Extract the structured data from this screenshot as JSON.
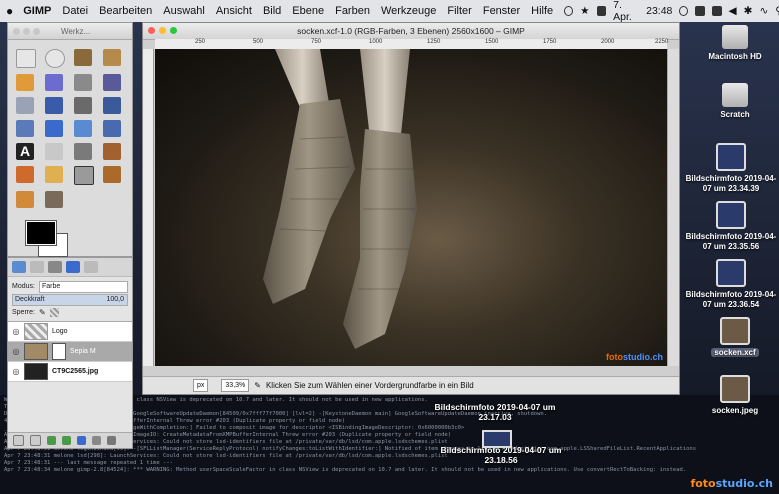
{
  "menubar": {
    "apple": "",
    "app_name": "GIMP",
    "items": [
      "Datei",
      "Bearbeiten",
      "Auswahl",
      "Ansicht",
      "Bild",
      "Ebene",
      "Farben",
      "Werkzeuge",
      "Filter",
      "Fenster",
      "Hilfe"
    ],
    "date": "7. Apr.",
    "time": "23:48"
  },
  "toolbox": {
    "title": "Werkz..."
  },
  "image_window": {
    "title": "socken.xcf-1.0 (RGB-Farben, 3 Ebenen) 2560x1600 – GIMP",
    "ruler_ticks": [
      "250",
      "500",
      "750",
      "1000",
      "1250",
      "1500",
      "1750",
      "2000",
      "2250"
    ],
    "unit": "px",
    "zoom": "33,3%",
    "status_text": "Klicken Sie zum Wählen einer Vordergrundfarbe in ein Bild",
    "watermark_a": "foto",
    "watermark_b": "studio.ch"
  },
  "layers": {
    "mode_label": "Modus:",
    "mode_value": "Farbe",
    "opacity_label": "Deckkraft",
    "opacity_value": "100,0",
    "lock_label": "Sperre:",
    "items": [
      {
        "name": "Logo"
      },
      {
        "name": "Sepia M"
      },
      {
        "name": "CT9C2565.jpg"
      }
    ]
  },
  "desktop": {
    "icons": [
      {
        "label": "Macintosh HD"
      },
      {
        "label": "Scratch"
      },
      {
        "label": "Bildschirmfoto 2019-04-07 um 23.34.39"
      },
      {
        "label": "Bildschirmfoto 2019-04-07 um 23.35.56"
      },
      {
        "label": "Bildschirmfoto 2019-04-07 um 23.36.54"
      },
      {
        "label": "socken.xcf"
      },
      {
        "label": "socken.jpeg"
      }
    ],
    "center_icons": [
      {
        "label": "Bildschirmfoto 2019-04-07 um 23.17.03"
      },
      {
        "label": "Bildschirmfoto 2019-04-07 um 23.18.56"
      }
    ],
    "watermark_a": "foto",
    "watermark_b": "studio.ch"
  },
  "terminal": {
    "lines": [
      "WARNING: Method userSpaceScaleFactor in class NSView is deprecated on 10.7 and later. It should not be used in new applications.",
      "ToolLoadEntitlements failed error=22",
      "Daemon[84509]: 2019-04-07 23:48:13.265 GoogleSoftwareUpdateDaemon[84509/0x7fff77f7000] [lvl=2] -[KeystoneDaemon main] GoogleSoftwareUpdateDaemon inactive, shutdown.",
      "4522]: ImageIO: CreateMetadataFromXMPBufferInternal  Threw error #203 (Duplicate property or field node)",
      "_1.86] - [ISGeneratelmageOp generatelmageWithCompletion:] Failed to composit image for descriptor <ISBindingImageDescriptor: 0x6000000b3c0>",
      "Apr 7 23:48:14 melone mdworker[84442]: ImageIO: CreateMetadataFromXMPBufferInternal  Threw error #203 (Duplicate property or field node)",
      "Apr 7 23:48:29 melone lsd[298]: LaunchServices: Could not store lsd-identifiers file at /private/var/db/lsd/com.apple.lsdschemes.plist",
      "Apr 7 23:48:31 melone loginwindow[99]: -[SFLListManager(ServiceReplyProtocol) notifyChanges:toListWithIdentifier:] Notified of item changes to list with identifier com.apple.LSSharedFileList.RecentApplications",
      "Apr 7 23:48:31 melone lsd[298]: LaunchServices: Could not store lsd-identifiers file at /private/var/db/lsd/com.apple.lsdschemes.plist",
      "Apr 7 23:48:31 --- last message repeated 1 time ---",
      "Apr 7 23:48:34 melone gimp-2.8[84524]: *** WARNING: Method userSpaceScaleFactor in class NSView is deprecated on 10.7 and later. It should not be used in new applications. Use convertRectToBacking: instead."
    ]
  }
}
